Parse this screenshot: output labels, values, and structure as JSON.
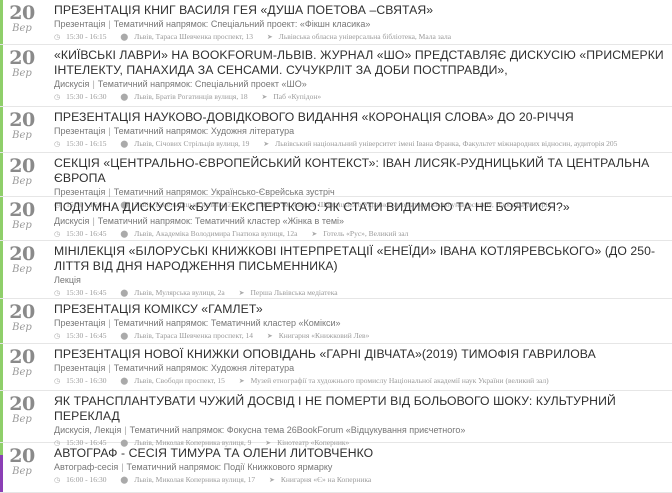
{
  "events": [
    {
      "day": "20",
      "weekday": "Вер",
      "title": "Презентація книг Василя Гея «Душа поетова –святая»",
      "type": "Презентація",
      "theme_label": "Тематичний напрямок:",
      "theme": "Спеціальний проект: «Фікшн класика»",
      "time": "15:30 - 16:15",
      "place": "Львів, Тараса Шевченка проспект, 13",
      "venue": "Львівська обласна універсальна бібліотека, Мала зала"
    },
    {
      "day": "20",
      "weekday": "Вер",
      "title": "«Київські лаври» на BookForum-Львів. Журнал «ШО» представляє дискусію «Присмерки інтелекту, панахида за сенсами. Сучукрліт за доби постправди»,",
      "type": "Дискусія",
      "theme_label": "Тематичний напрямок:",
      "theme": "Спеціальний проект «ШО»",
      "time": "15:30 - 16:30",
      "place": "Львів, Братів Рогатинців вулиця, 18",
      "venue": "Паб «Купідон»"
    },
    {
      "day": "20",
      "weekday": "Вер",
      "title": "Презентація науково-довідкового видання «Коронація слова» до 20-річчя",
      "type": "Презентація",
      "theme_label": "Тематичний напрямок:",
      "theme": "Художня література",
      "time": "15:30 - 16:15",
      "place": "Львів, Січових Стрільців вулиця, 19",
      "venue": "Львівський національний університет імені Івана Франка, Факультет міжнародних відносин, аудиторія 205"
    },
    {
      "day": "20",
      "weekday": "Вер",
      "title": "Секція «Центрально-європейський контекст»: Іван Лисяк-Рудницький та Центральна Європа",
      "type": "Презентація",
      "theme_label": "Тематичний напрямок:",
      "theme": "Українсько-Єврейська зустріч",
      "time": "15:30 - 16:00",
      "place": "Львів, Козельницька вулиця, 2а",
      "venue": "Центр ім. Андрея Шептицького Українського католицького університету, Парова аудиторія"
    },
    {
      "day": "20",
      "weekday": "Вер",
      "title": "Подіумна дискусія «Бути експерткою: як стати видимою та не боятися?»",
      "type": "Дискусія",
      "theme_label": "Тематичний напрямок:",
      "theme": "Тематичний кластер «Жінка в темі»",
      "time": "15:30 - 16:45",
      "place": "Львів, Академіка Володимира Гнатюка вулиця, 12а",
      "venue": "Готель «Рус», Великий зал"
    },
    {
      "day": "20",
      "weekday": "Вер",
      "title": "Мінілекція «Білоруські книжкові інтерпретації «Енеїди» Івана Котляревського» (до 250-ліття від дня народження письменника)",
      "type": "Лекція",
      "theme_label": "",
      "theme": "",
      "time": "15:30 - 16:45",
      "place": "Львів, Мулярська вулиця, 2а",
      "venue": "Перша Львівська медіатека"
    },
    {
      "day": "20",
      "weekday": "Вер",
      "title": "Презентація коміксу «Гамлет»",
      "type": "Презентація",
      "theme_label": "Тематичний напрямок:",
      "theme": "Тематичний кластер «Комікси»",
      "time": "15:30 - 16:45",
      "place": "Львів, Тараса Шевченка проспект, 14",
      "venue": "Книгарня «Книжковий Лев»"
    },
    {
      "day": "20",
      "weekday": "Вер",
      "title": "Презентація нової книжки оповідань «Гарні дівчата»(2019) Тимофія Гаврилова",
      "type": "Презентація",
      "theme_label": "Тематичний напрямок:",
      "theme": "Художня література",
      "time": "15:30 - 16:30",
      "place": "Львів, Свободи проспект, 15",
      "venue": "Музей етнографії та художнього промислу Національної академії наук України (великий зал)"
    },
    {
      "day": "20",
      "weekday": "Вер",
      "title": "Як трансплантувати чужий досвід і не померти від больового шоку: культурний переклад",
      "type": "Дискусія, Лекція",
      "theme_label": "Тематичний напрямок:",
      "theme": "Фокусна тема 26BookForum «Відцукування приєчетного»",
      "time": "15:30 - 16:45",
      "place": "Львів, Миколая Коперника вулиця, 9",
      "venue": "Кінотеатр «Коперник»"
    },
    {
      "day": "20",
      "weekday": "Вер",
      "title": "Автограф - сесія Тимура та Олени Литовченко",
      "type": "Автограф-сесія",
      "theme_label": "Тематичний напрямок:",
      "theme": "Події Книжкового ярмарку",
      "time": "16:00 - 16:30",
      "place": "Львів, Миколая Коперника вулиця, 17",
      "venue": "Книгарня «Є» на Коперника"
    }
  ]
}
